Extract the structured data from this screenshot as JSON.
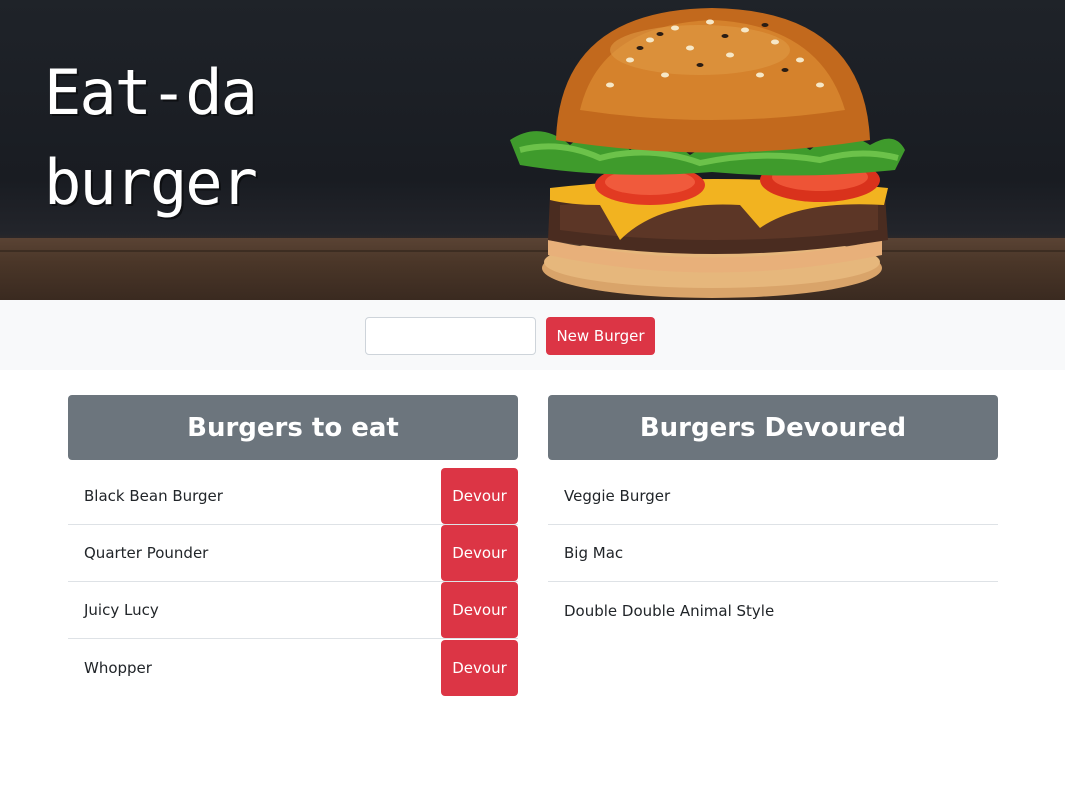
{
  "hero": {
    "title_line1": "Eat-da",
    "title_line2": "burger"
  },
  "form": {
    "input_value": "",
    "input_placeholder": "",
    "submit_label": "New Burger"
  },
  "to_eat": {
    "title": "Burgers to eat",
    "button_label": "Devour",
    "items": [
      {
        "name": "Black Bean Burger"
      },
      {
        "name": "Quarter Pounder"
      },
      {
        "name": "Juicy Lucy"
      },
      {
        "name": "Whopper"
      }
    ]
  },
  "devoured": {
    "title": "Burgers Devoured",
    "items": [
      {
        "name": "Veggie Burger"
      },
      {
        "name": "Big Mac"
      },
      {
        "name": "Double Double Animal Style"
      }
    ]
  },
  "colors": {
    "accent_red": "#dc3545",
    "header_gray": "#6c757d",
    "form_bar_bg": "#f8f9fa"
  }
}
